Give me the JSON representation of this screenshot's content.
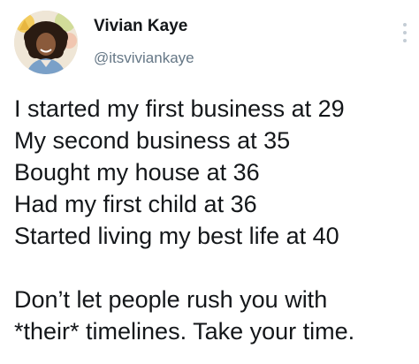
{
  "tweet": {
    "author": {
      "name": "Vivian Kaye",
      "handle": "@itsviviankaye",
      "avatar_icon": "profile-photo"
    },
    "more_icon": "more-vertical-icon",
    "lines": [
      "I started my first business at 29",
      "My second business at 35",
      "Bought my house at 36",
      "Had my first child at 36",
      "Started living my best life at 40",
      "Don’t let people rush you with",
      "*their* timelines. Take your time."
    ]
  },
  "colors": {
    "text_primary": "#14171a",
    "text_secondary": "#657786",
    "background": "#ffffff"
  }
}
